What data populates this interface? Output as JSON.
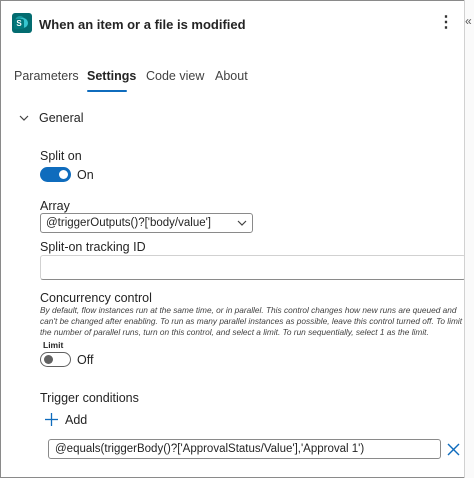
{
  "header": {
    "title": "When an item or a file is modified",
    "app_icon": "sharepoint-icon",
    "app_icon_letter": "S",
    "more_icon": "more-vertical-icon"
  },
  "tabs": [
    {
      "label": "Parameters",
      "active": false
    },
    {
      "label": "Settings",
      "active": true
    },
    {
      "label": "Code view",
      "active": false
    },
    {
      "label": "About",
      "active": false
    }
  ],
  "general": {
    "title": "General",
    "split_on": {
      "label": "Split on",
      "state": "On",
      "enabled": true
    },
    "array": {
      "label": "Array",
      "value": "@triggerOutputs()?['body/value']"
    },
    "tracking_id": {
      "label": "Split-on tracking ID",
      "value": ""
    },
    "concurrency": {
      "label": "Concurrency control",
      "description": "By default, flow instances run at the same time, or in parallel. This control changes how new runs are queued and can't be changed after enabling. To run as many parallel instances as possible, leave this control turned off. To limit the number of parallel runs, turn on this control, and select a limit. To run sequentially, select 1 as the limit.",
      "limit_label": "Limit",
      "state": "Off",
      "enabled": false
    },
    "trigger_conditions": {
      "label": "Trigger conditions",
      "add_label": "Add",
      "conditions": [
        "@equals(triggerBody()?['ApprovalStatus/Value'],'Approval 1')"
      ]
    }
  },
  "colors": {
    "accent": "#0f6cbd",
    "delete": "#0f6cbd"
  }
}
